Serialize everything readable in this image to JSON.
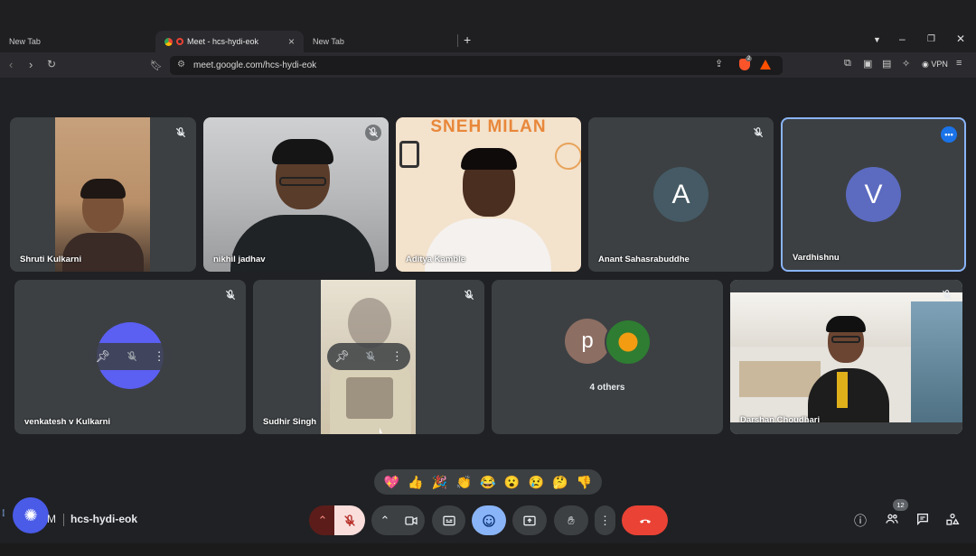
{
  "browser": {
    "tabs": [
      {
        "label": "New Tab"
      },
      {
        "label": "Meet - hcs-hydi-eok"
      },
      {
        "label": "New Tab"
      }
    ],
    "url": "meet.google.com/hcs-hydi-eok",
    "vpn_label": "VPN",
    "brave_count": "2"
  },
  "meeting": {
    "code": "hcs-hydi-eok",
    "time_fragment": "M",
    "participant_count": "12"
  },
  "tiles": [
    {
      "name": "Shruti Kulkarni",
      "muted": true
    },
    {
      "name": "nikhil jadhav",
      "muted": true
    },
    {
      "name": "Aditya Kamble",
      "muted": false
    },
    {
      "name": "Anant Sahasrabuddhe",
      "muted": true,
      "avatar_letter": "A",
      "avatar_color": "#455a64"
    },
    {
      "name": "Vardhishnu",
      "muted": false,
      "avatar_letter": "V",
      "avatar_color": "#5c6bc0"
    },
    {
      "name": "venkatesh v Kulkarni",
      "muted": true
    },
    {
      "name": "Sudhir Singh",
      "muted": true
    },
    {
      "name": "4 others",
      "avatar_letter": "p",
      "avatar_color": "#8d6e63"
    },
    {
      "name": "Darshan Choudhari",
      "muted": true
    }
  ],
  "banner_text": "SNEH MILAN",
  "reactions": [
    "💖",
    "👍",
    "🎉",
    "👏",
    "😂",
    "😮",
    "😢",
    "🤔",
    "👎"
  ],
  "colors": {
    "accent": "#8ab4f8",
    "end_call": "#ea4335",
    "mic_off_bg": "#f9dedc",
    "active_button": "#8ab4f8"
  }
}
